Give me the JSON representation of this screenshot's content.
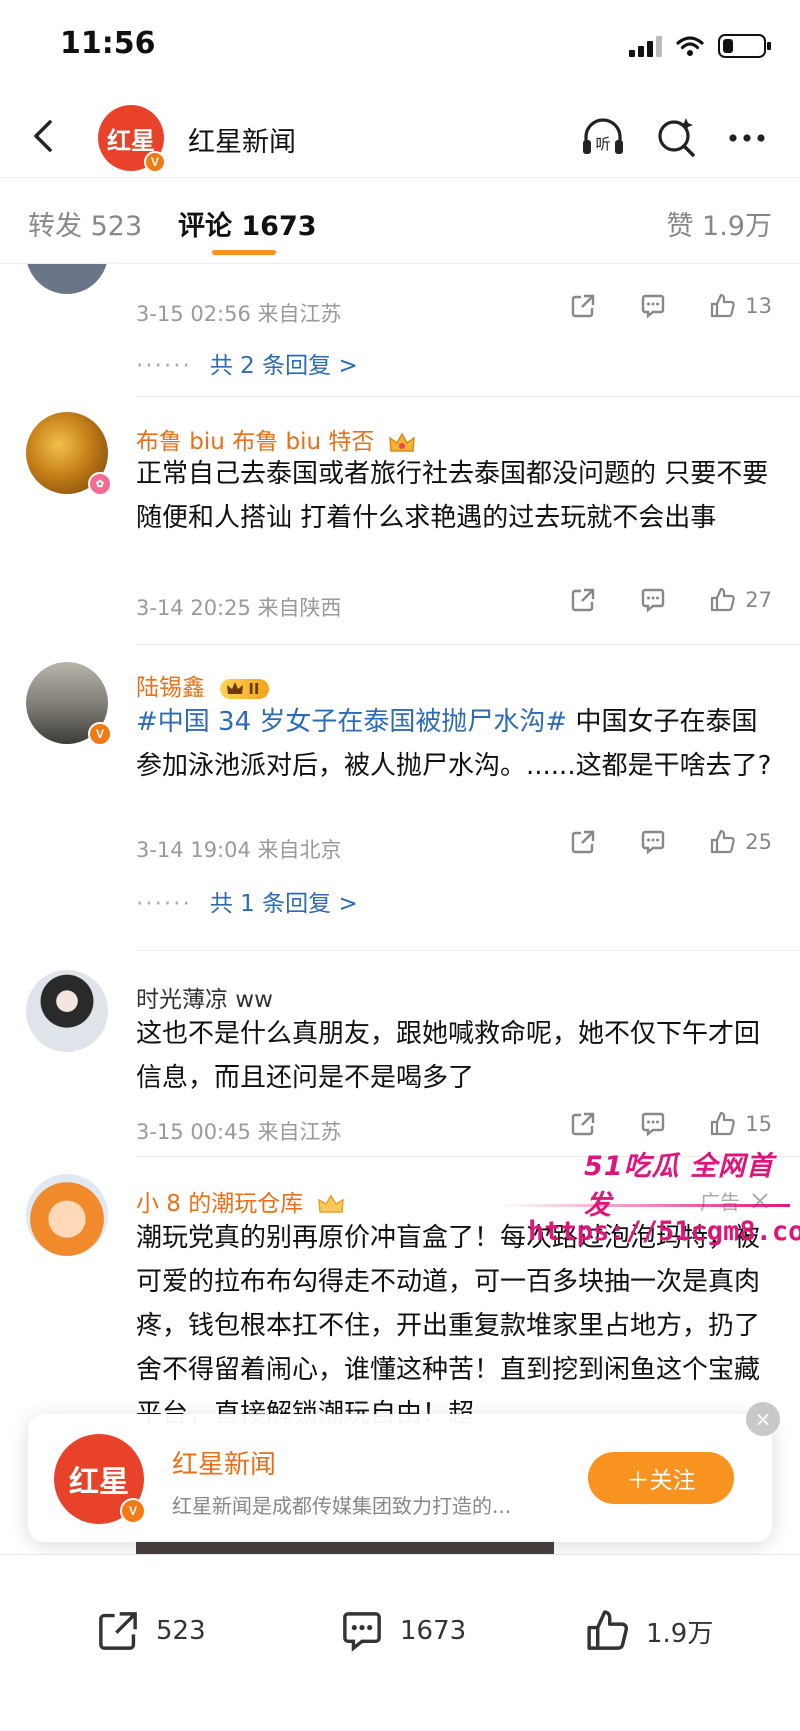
{
  "status_bar": {
    "time": "11:56",
    "battery_level": 0.25
  },
  "header": {
    "logo_text": "红星",
    "verified_mark": "V",
    "title": "红星新闻",
    "listen_label": "听"
  },
  "tabs": {
    "repost": "转发 523",
    "comments": "评论 1673",
    "likes": "赞 1.9万"
  },
  "comments": [
    {
      "meta": "3-15 02:56  来自江苏",
      "likes": "13",
      "replies": "共 2 条回复 >"
    },
    {
      "user": "布鲁 biu 布鲁 biu 特否",
      "text": "正常自己去泰国或者旅行社去泰国都没问题的 只要不要随便和人搭讪 打着什么求艳遇的过去玩就不会出事",
      "meta": "3-14 20:25  来自陕西",
      "likes": "27"
    },
    {
      "user": "陆锡鑫",
      "level": "II",
      "hashtag": "#中国 34 岁女子在泰国被抛尸水沟#",
      "text": " 中国女子在泰国参加泳池派对后，被人抛尸水沟。......这都是干啥去了?",
      "meta": "3-14 19:04  来自北京",
      "likes": "25",
      "replies": "共 1 条回复 >"
    },
    {
      "user": "时光薄凉 ww",
      "text": "这也不是什么真朋友，跟她喊救命呢，她不仅下午才回信息，而且还问是不是喝多了",
      "meta": "3-15 00:45  来自江苏",
      "likes": "15"
    },
    {
      "user": "小 8 的潮玩仓库",
      "ad_label": "广告",
      "text": "潮玩党真的别再原价冲盲盒了！每次路过泡泡玛特，被可爱的拉布布勾得走不动道，可一百多块抽一次是真肉疼，钱包根本扛不住，开出重复款堆家里占地方，扔了舍不得留着闹心，谁懂这种苦！直到挖到闲鱼这个宝藏平台，直接解锁潮玩自由！超"
    }
  ],
  "watermark": {
    "line1": "51吃瓜 全网首发",
    "line2": "https://51cgm8.com"
  },
  "follow_card": {
    "logo_text": "红星",
    "name": "红星新闻",
    "desc": "红星新闻是成都传媒集团致力打造的...",
    "follow_label": "＋关注",
    "close_label": "×"
  },
  "bottom_bar": {
    "reposts": "523",
    "comments": "1673",
    "likes": "1.9万"
  }
}
